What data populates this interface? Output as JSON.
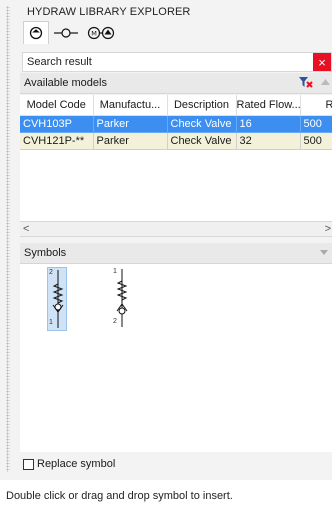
{
  "window": {
    "title": "HYDRAW LIBRARY EXPLORER"
  },
  "toolbar": {
    "tools": [
      "valve-tool-icon",
      "line-tool-icon",
      "motor-pump-tool-icon"
    ]
  },
  "search": {
    "label": "Search result",
    "close_label": "×"
  },
  "models": {
    "header": "Available models",
    "columns": [
      "Model Code",
      "Manufactu...",
      "Description",
      "Rated Flow...",
      "Ra"
    ],
    "rows": [
      {
        "cells": [
          "CVH103P",
          "Parker",
          "Check Valve",
          "16",
          "500"
        ],
        "selected": true
      },
      {
        "cells": [
          "CVH121P-**",
          "Parker",
          "Check Valve",
          "32",
          "500"
        ],
        "selected": false
      }
    ]
  },
  "scrollbar": {
    "left": "<",
    "right": ">"
  },
  "symbols": {
    "header": "Symbols",
    "items": [
      {
        "top_label": "2",
        "bottom_label": "1",
        "selected": true
      },
      {
        "top_label": "1",
        "bottom_label": "2",
        "selected": false
      }
    ]
  },
  "replace": {
    "label": "Replace symbol",
    "checked": false
  },
  "status": {
    "text": "Double click or drag and drop symbol to insert."
  },
  "colors": {
    "selection": "#3c8ef0",
    "alt_row": "#f4f1da",
    "close": "#e81123"
  }
}
